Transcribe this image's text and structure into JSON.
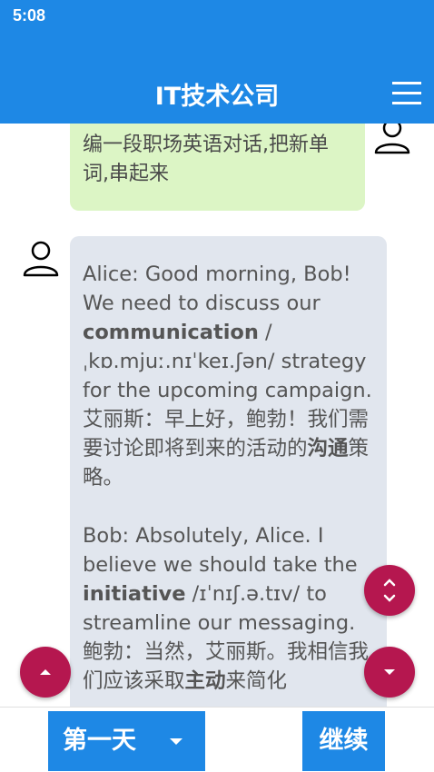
{
  "status_bar": {
    "time": "5:08"
  },
  "header": {
    "title": "IT技术公司",
    "menu_icon": "hamburger-menu-icon"
  },
  "chat": {
    "user_message": "编一段职场英语对话,把新单词,串起来",
    "bot_message": {
      "alice_en_before": "Alice: Good morning, Bob! We need to discuss our ",
      "alice_word": "communication",
      "alice_en_after": " /ˌkɒ.mjuː.nɪˈkeɪ.ʃən/ strategy for the upcoming campaign.",
      "alice_zh_before": "艾丽斯：早上好，鲍勃！我们需要讨论即将到来的活动的",
      "alice_zh_word": "沟通",
      "alice_zh_after": "策略。",
      "bob_en_before": "Bob: Absolutely, Alice. I believe we should take the ",
      "bob_word": "initiative",
      "bob_en_after": " /ɪˈnɪʃ.ə.tɪv/ to streamline our messaging.",
      "bob_zh_before": "鲍勃：当然，艾丽斯。我相信我们应该采取",
      "bob_zh_word": "主动",
      "bob_zh_after": "来简化"
    }
  },
  "bottom_bar": {
    "day_label": "第一天",
    "continue_label": "继续"
  },
  "colors": {
    "primary": "#1e88e5",
    "accent": "#b5174f",
    "user_bubble": "#dcf5c5",
    "bot_bubble": "#e1e6ee"
  }
}
